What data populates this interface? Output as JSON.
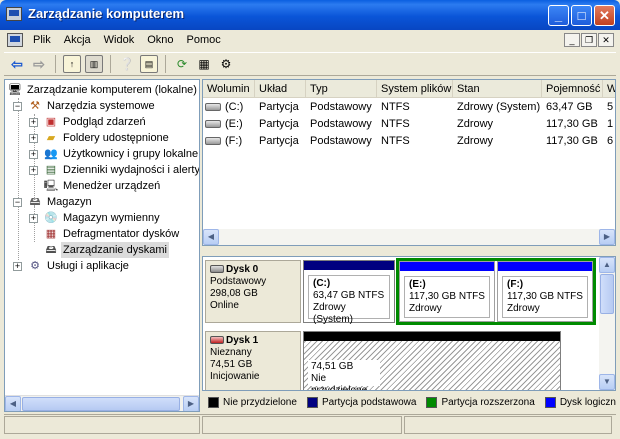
{
  "window": {
    "title": "Zarządzanie komputerem"
  },
  "menu": {
    "items": [
      "Plik",
      "Akcja",
      "Widok",
      "Okno",
      "Pomoc"
    ]
  },
  "tree": {
    "root": "Zarządzanie komputerem (lokalne)",
    "system_tools": "Narzędzia systemowe",
    "event_viewer": "Podgląd zdarzeń",
    "shared_folders": "Foldery udostępnione",
    "users_groups": "Użytkownicy i grupy lokalne",
    "perf_logs": "Dzienniki wydajności i alerty",
    "device_manager": "Menedżer urządzeń",
    "storage": "Magazyn",
    "removable": "Magazyn wymienny",
    "defrag": "Defragmentator dysków",
    "disk_mgmt": "Zarządzanie dyskami",
    "services_apps": "Usługi i aplikacje"
  },
  "list": {
    "columns": [
      "Wolumin",
      "Układ",
      "Typ",
      "System plików",
      "Stan",
      "Pojemność",
      "W"
    ],
    "rows": [
      [
        "(C:)",
        "Partycja",
        "Podstawowy",
        "NTFS",
        "Zdrowy (System)",
        "63,47 GB",
        "5"
      ],
      [
        "(E:)",
        "Partycja",
        "Podstawowy",
        "NTFS",
        "Zdrowy",
        "117,30 GB",
        "1"
      ],
      [
        "(F:)",
        "Partycja",
        "Podstawowy",
        "NTFS",
        "Zdrowy",
        "117,30 GB",
        "6"
      ]
    ]
  },
  "disks": {
    "disk0": {
      "name": "Dysk 0",
      "type": "Podstawowy",
      "size": "298,08 GB",
      "status": "Online",
      "parts": [
        {
          "label": "(C:)",
          "size": "63,47 GB NTFS",
          "state": "Zdrowy (System)"
        },
        {
          "label": "(E:)",
          "size": "117,30 GB NTFS",
          "state": "Zdrowy"
        },
        {
          "label": "(F:)",
          "size": "117,30 GB NTFS",
          "state": "Zdrowy"
        }
      ]
    },
    "disk1": {
      "name": "Dysk 1",
      "type": "Nieznany",
      "size": "74,51 GB",
      "status": "Inicjowanie",
      "unalloc_size": "74,51 GB",
      "unalloc_label": "Nie przydzielone"
    }
  },
  "legend": [
    {
      "label": "Nie przydzielone",
      "color": "#000000"
    },
    {
      "label": "Partycja podstawowa",
      "color": "#000080"
    },
    {
      "label": "Partycja rozszerzona",
      "color": "#008A00"
    },
    {
      "label": "Dysk logiczny",
      "color": "#0000FF"
    }
  ],
  "colors": {
    "primary_bar": "#000080",
    "logical_bar": "#0000FF",
    "unalloc_bar": "#000000",
    "extended_border": "#008A00"
  }
}
